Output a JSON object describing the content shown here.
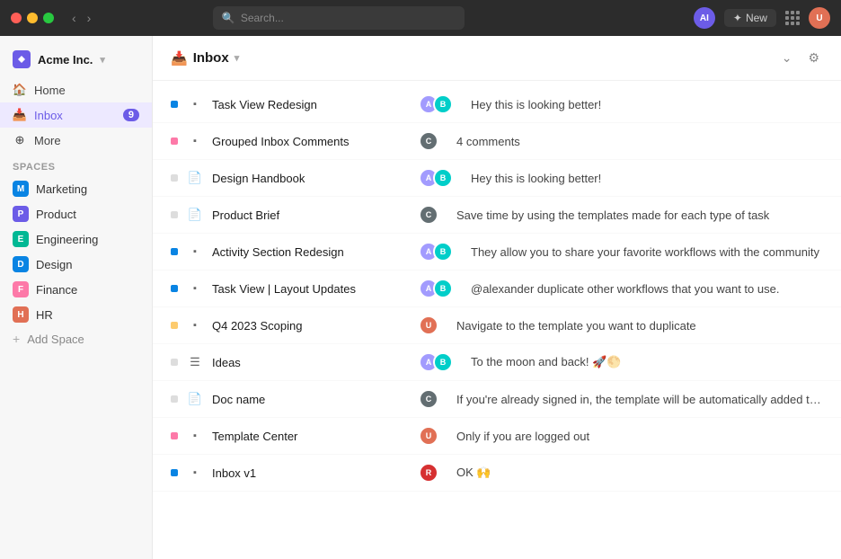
{
  "titlebar": {
    "dots": [
      "red",
      "yellow",
      "green"
    ],
    "search_placeholder": "Search...",
    "ai_label": "AI",
    "new_label": "New",
    "user_initials": "U"
  },
  "sidebar": {
    "brand": {
      "name": "Acme Inc.",
      "chevron": "▾"
    },
    "nav": [
      {
        "id": "home",
        "label": "Home",
        "icon": "🏠",
        "active": false
      },
      {
        "id": "inbox",
        "label": "Inbox",
        "icon": "📥",
        "active": true,
        "badge": "9"
      },
      {
        "id": "more",
        "label": "More",
        "icon": "⊕",
        "active": false
      }
    ],
    "spaces_label": "Spaces",
    "spaces": [
      {
        "id": "marketing",
        "label": "Marketing",
        "color": "#0984e3",
        "letter": "M"
      },
      {
        "id": "product",
        "label": "Product",
        "color": "#6c5ce7",
        "letter": "P"
      },
      {
        "id": "engineering",
        "label": "Engineering",
        "color": "#00b894",
        "letter": "E"
      },
      {
        "id": "design",
        "label": "Design",
        "color": "#0984e3",
        "letter": "D"
      },
      {
        "id": "finance",
        "label": "Finance",
        "color": "#fd79a8",
        "letter": "F"
      },
      {
        "id": "hr",
        "label": "HR",
        "color": "#e17055",
        "letter": "H"
      }
    ],
    "add_space_label": "Add Space"
  },
  "content": {
    "header": {
      "title": "Inbox",
      "icon": "📥",
      "chevron": "▾"
    },
    "rows": [
      {
        "id": "task-view-redesign",
        "indicator_color": "#0984e3",
        "icon_type": "square",
        "title": "Task View Redesign",
        "avatars": [
          {
            "color": "#a29bfe",
            "letter": "A"
          },
          {
            "color": "#00cec9",
            "letter": "B"
          }
        ],
        "comment": "Hey this is looking better!",
        "comment_type": "text"
      },
      {
        "id": "grouped-inbox-comments",
        "indicator_color": "#fd79a8",
        "icon_type": "square",
        "title": "Grouped Inbox Comments",
        "avatars": [
          {
            "color": "#636e72",
            "letter": "C"
          }
        ],
        "comment": "4 comments",
        "comment_type": "meta"
      },
      {
        "id": "design-handbook",
        "indicator_color": "#ddd",
        "icon_type": "doc",
        "title": "Design Handbook",
        "avatars": [
          {
            "color": "#a29bfe",
            "letter": "A"
          },
          {
            "color": "#00cec9",
            "letter": "B"
          }
        ],
        "comment": "Hey this is looking better!",
        "comment_type": "text"
      },
      {
        "id": "product-brief",
        "indicator_color": "#ddd",
        "icon_type": "doc",
        "title": "Product Brief",
        "avatars": [
          {
            "color": "#636e72",
            "letter": "C"
          }
        ],
        "comment": "Save time by using the templates made for each type of task",
        "comment_type": "text"
      },
      {
        "id": "activity-section-redesign",
        "indicator_color": "#0984e3",
        "icon_type": "square",
        "title": "Activity Section Redesign",
        "avatars": [
          {
            "color": "#a29bfe",
            "letter": "A"
          },
          {
            "color": "#00cec9",
            "letter": "B"
          }
        ],
        "comment": "They allow you to share your favorite workflows with the community",
        "comment_type": "text"
      },
      {
        "id": "task-view-layout",
        "indicator_color": "#0984e3",
        "icon_type": "square",
        "title": "Task View | Layout Updates",
        "avatars": [
          {
            "color": "#a29bfe",
            "letter": "A"
          },
          {
            "color": "#00cec9",
            "letter": "B"
          }
        ],
        "comment": "@alexander duplicate other workflows that you want to use.",
        "comment_type": "text"
      },
      {
        "id": "q4-2023-scoping",
        "indicator_color": "#fdcb6e",
        "icon_type": "square",
        "title": "Q4 2023 Scoping",
        "avatars": [
          {
            "color": "#e17055",
            "letter": "U"
          }
        ],
        "comment": "Navigate to the template you want to duplicate",
        "comment_type": "text"
      },
      {
        "id": "ideas",
        "indicator_color": "#ddd",
        "icon_type": "lines",
        "title": "Ideas",
        "avatars": [
          {
            "color": "#a29bfe",
            "letter": "A"
          },
          {
            "color": "#00cec9",
            "letter": "B"
          }
        ],
        "comment": "To the moon and back! 🚀🌕",
        "comment_type": "text"
      },
      {
        "id": "doc-name",
        "indicator_color": "#ddd",
        "icon_type": "doc",
        "title": "Doc name",
        "avatars": [
          {
            "color": "#636e72",
            "letter": "C"
          }
        ],
        "comment": "If you're already signed in, the template will be automatically added to your...",
        "comment_type": "text"
      },
      {
        "id": "template-center",
        "indicator_color": "#fd79a8",
        "icon_type": "square",
        "title": "Template Center",
        "avatars": [
          {
            "color": "#e17055",
            "letter": "U"
          }
        ],
        "comment": "Only if you are logged out",
        "comment_type": "text"
      },
      {
        "id": "inbox-v1",
        "indicator_color": "#0984e3",
        "icon_type": "square",
        "title": "Inbox v1",
        "avatars": [
          {
            "color": "#d63031",
            "letter": "R"
          }
        ],
        "comment": "OK 🙌",
        "comment_type": "text"
      }
    ]
  }
}
